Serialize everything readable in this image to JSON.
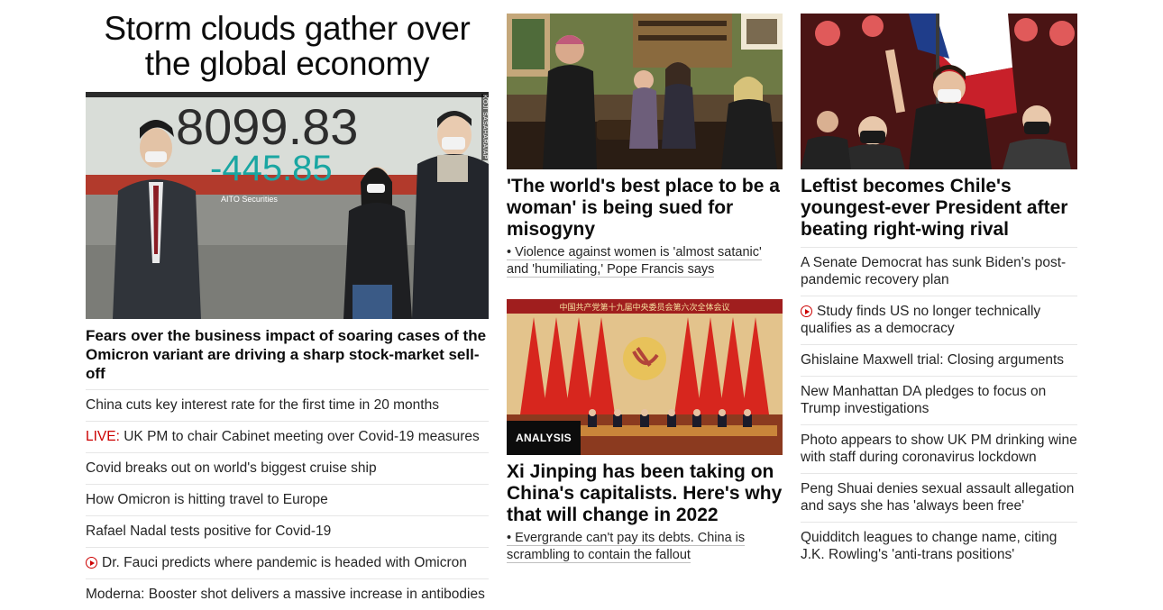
{
  "col1": {
    "hero_title": "Storm clouds gather over the global economy",
    "image_credit": "KOJI SASAHARA/AP",
    "board_number": "8099.83",
    "board_change": "-445.85",
    "board_brand": "AITO Securities",
    "lead_headline": "Fears over the business impact of soaring cases of the Omicron variant are driving a sharp stock-market sell-off",
    "links": [
      {
        "text": "China cuts key interest rate for the first time in 20 months"
      },
      {
        "prefix": "LIVE:",
        "text": " UK PM to chair Cabinet meeting over Covid-19 measures"
      },
      {
        "text": "Covid breaks out on world's biggest cruise ship"
      },
      {
        "text": "How Omicron is hitting travel to Europe"
      },
      {
        "text": "Rafael Nadal tests positive for Covid-19"
      },
      {
        "icon": "play-icon",
        "text": "Dr. Fauci predicts where pandemic is headed with Omicron"
      },
      {
        "text": "Moderna: Booster shot delivers a massive increase in antibodies"
      }
    ]
  },
  "col2": {
    "story1": {
      "headline": "'The world's best place to be a woman' is being sued for misogyny",
      "sub": "• Violence against women is 'almost satanic' and 'humiliating,' Pope Francis says"
    },
    "story2": {
      "banner_text": "中国共产党第十九届中央委员会第六次全体会议",
      "badge": "ANALYSIS",
      "headline": "Xi Jinping has been taking on China's capitalists. Here's why that will change in 2022",
      "sub": "• Evergrande can't pay its debts. China is scrambling to contain the fallout"
    }
  },
  "col3": {
    "headline": "Leftist becomes Chile's youngest-ever President after beating right-wing rival",
    "links": [
      {
        "text": "A Senate Democrat has sunk Biden's post-pandemic recovery plan"
      },
      {
        "icon": "play-icon",
        "text": "Study finds US no longer technically qualifies as a democracy"
      },
      {
        "text": "Ghislaine Maxwell trial: Closing arguments"
      },
      {
        "text": "New Manhattan DA pledges to focus on Trump investigations"
      },
      {
        "text": "Photo appears to show UK PM drinking wine with staff during coronavirus lockdown"
      },
      {
        "text": "Peng Shuai denies sexual assault allegation and says she has 'always been free'"
      },
      {
        "text": "Quidditch leagues to change name, citing J.K. Rowling's 'anti-trans positions'"
      }
    ]
  },
  "colors": {
    "text": "#0c0c0c",
    "live_red": "#cc0000",
    "divider": "#e6e6e6",
    "badge_bg": "#0c0c0c"
  }
}
